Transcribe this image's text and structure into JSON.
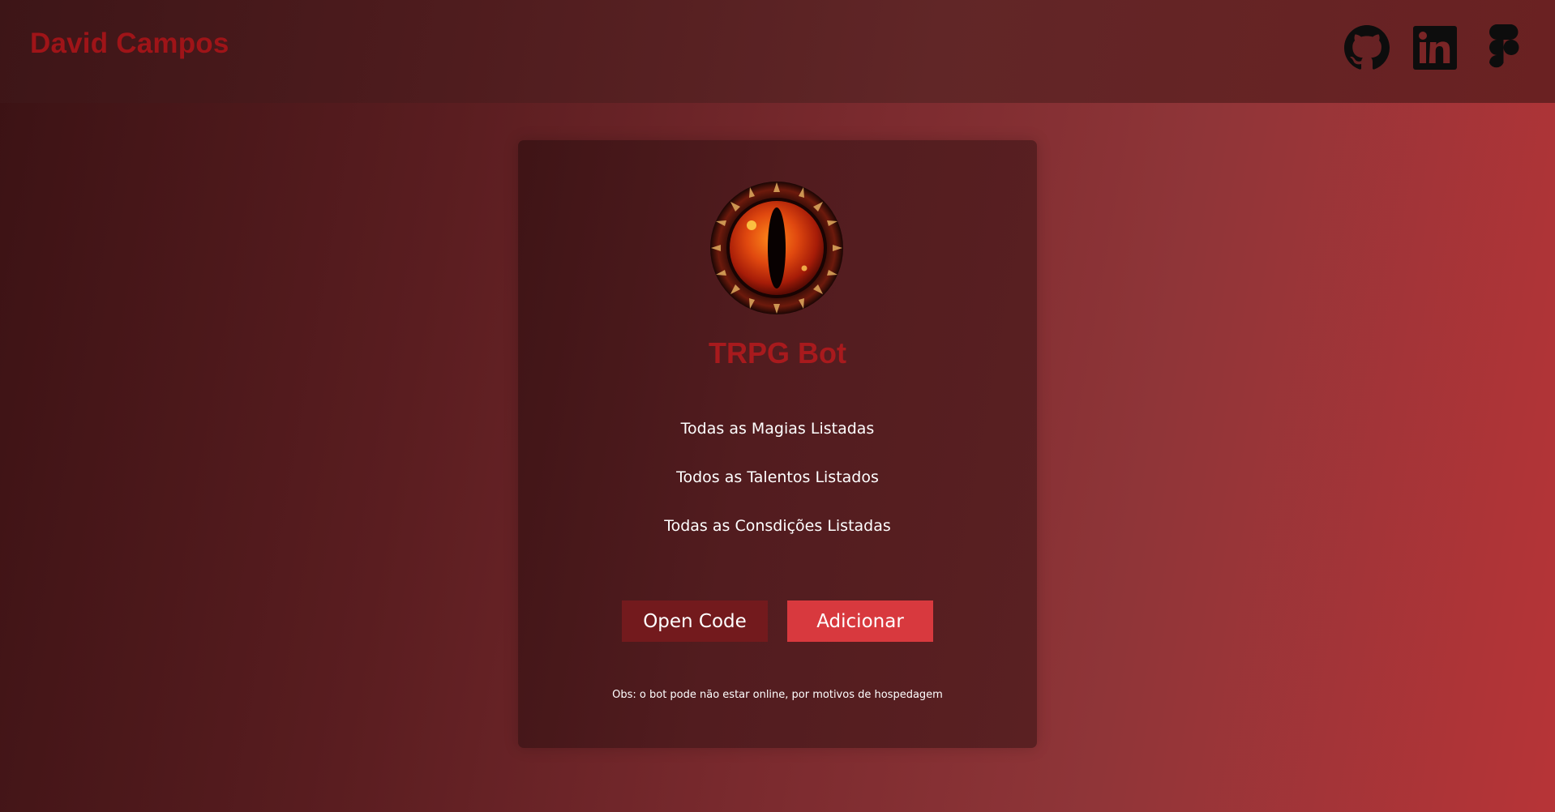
{
  "header": {
    "brand": "David Campos",
    "social": [
      {
        "name": "GitHub",
        "icon": "github-icon"
      },
      {
        "name": "LinkedIn",
        "icon": "linkedin-icon"
      },
      {
        "name": "Figma",
        "icon": "figma-icon"
      }
    ]
  },
  "card": {
    "logo_icon": "dragon-eye-icon",
    "title": "TRPG Bot",
    "features": [
      "Todas as Magias Listadas",
      "Todos as Talentos Listados",
      "Todas as Consdições Listadas"
    ],
    "buttons": {
      "open_code": "Open Code",
      "add": "Adicionar"
    },
    "note": "Obs: o bot pode não estar online, por motivos de hospedagem"
  },
  "colors": {
    "brand": "#9f1418",
    "title": "#a81a1d",
    "open_button": "#731a1d",
    "add_button": "#d8393e"
  }
}
